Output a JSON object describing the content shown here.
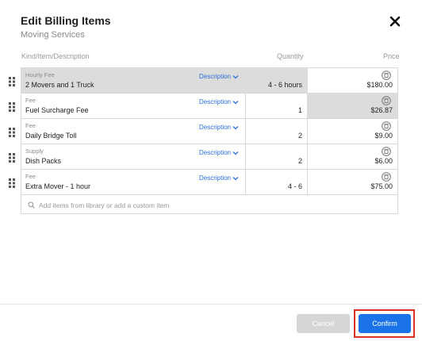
{
  "modal": {
    "title": "Edit Billing Items",
    "subtitle": "Moving Services"
  },
  "columns": {
    "kind": "Kind/Item/Description",
    "quantity": "Quantity",
    "price": "Price"
  },
  "items": [
    {
      "kind": "Hourly Fee",
      "name": "2 Movers and 1 Truck",
      "desc": "Description",
      "qty": "4 - 6 hours",
      "price": "$180.00"
    },
    {
      "kind": "Fee",
      "name": "Fuel Surcharge Fee",
      "desc": "Description",
      "qty": "1",
      "price": "$26.87"
    },
    {
      "kind": "Fee",
      "name": "Daily Bridge Toll",
      "desc": "Description",
      "qty": "2",
      "price": "$9.00"
    },
    {
      "kind": "Supply",
      "name": "Dish Packs",
      "desc": "Description",
      "qty": "2",
      "price": "$6.00"
    },
    {
      "kind": "Fee",
      "name": "Extra Mover - 1 hour",
      "desc": "Description",
      "qty": "4 - 6",
      "price": "$75.00"
    }
  ],
  "search": {
    "placeholder": "Add items from library or add a custom item"
  },
  "footer": {
    "cancel": "Cancel",
    "confirm": "Confirm"
  },
  "colors": {
    "accent": "#1a73e8",
    "link": "#2a6fd6",
    "highlight": "#dcdcdc",
    "annotation": "#d93025"
  }
}
